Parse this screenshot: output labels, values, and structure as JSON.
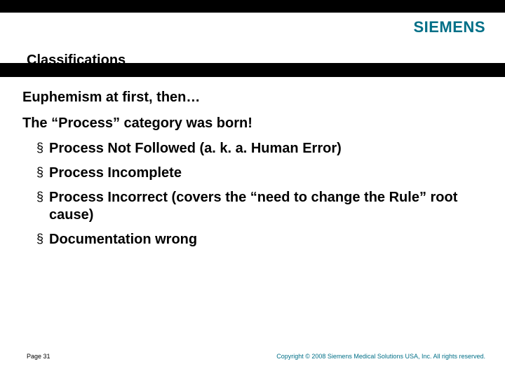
{
  "brand": "SIEMENS",
  "title": "Classifications",
  "body": {
    "line1": "Euphemism at first, then…",
    "line2": "The “Process” category was born!",
    "bullets": [
      "Process Not Followed (a. k. a.  Human Error)",
      "Process Incomplete",
      "Process Incorrect (covers the “need to change the Rule” root cause)",
      "Documentation wrong"
    ]
  },
  "footer": {
    "page": "Page 31",
    "copyright": "Copyright © 2008 Siemens Medical Solutions USA, Inc. All rights reserved."
  }
}
